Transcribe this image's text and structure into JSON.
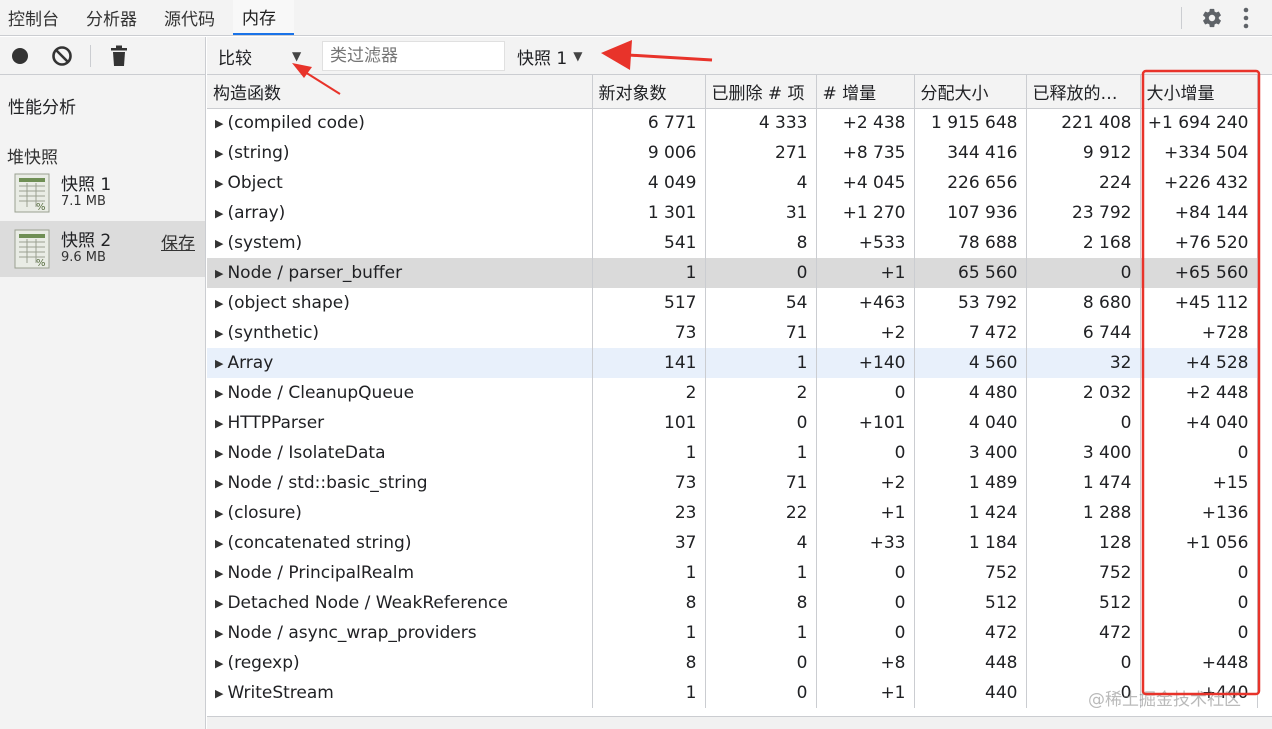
{
  "tabs": [
    {
      "label": "控制台"
    },
    {
      "label": "分析器"
    },
    {
      "label": "源代码"
    },
    {
      "label": "内存"
    }
  ],
  "sidebar": {
    "profiles_title": "性能分析",
    "heap_title": "堆快照",
    "snapshots": [
      {
        "name": "快照 1",
        "size": "7.1 MB"
      },
      {
        "name": "快照 2",
        "size": "9.6 MB",
        "action": "保存"
      }
    ]
  },
  "toolbar": {
    "view_label": "比较",
    "filter_placeholder": "类过滤器",
    "baseline_label": "快照 1"
  },
  "table": {
    "columns": [
      "构造函数",
      "新对象数",
      "已删除 # 项",
      "# 增量",
      "分配大小",
      "已释放的…",
      "大小增量"
    ],
    "rows": [
      {
        "name": "(compiled code)",
        "new": "6 771",
        "deleted": "4 333",
        "delta": "+2 438",
        "alloc": "1 915 648",
        "freed": "221 408",
        "size_delta": "+1 694 240"
      },
      {
        "name": "(string)",
        "new": "9 006",
        "deleted": "271",
        "delta": "+8 735",
        "alloc": "344 416",
        "freed": "9 912",
        "size_delta": "+334 504"
      },
      {
        "name": "Object",
        "new": "4 049",
        "deleted": "4",
        "delta": "+4 045",
        "alloc": "226 656",
        "freed": "224",
        "size_delta": "+226 432"
      },
      {
        "name": "(array)",
        "new": "1 301",
        "deleted": "31",
        "delta": "+1 270",
        "alloc": "107 936",
        "freed": "23 792",
        "size_delta": "+84 144"
      },
      {
        "name": "(system)",
        "new": "541",
        "deleted": "8",
        "delta": "+533",
        "alloc": "78 688",
        "freed": "2 168",
        "size_delta": "+76 520"
      },
      {
        "name": "Node / parser_buffer",
        "new": "1",
        "deleted": "0",
        "delta": "+1",
        "alloc": "65 560",
        "freed": "0",
        "size_delta": "+65 560"
      },
      {
        "name": "(object shape)",
        "new": "517",
        "deleted": "54",
        "delta": "+463",
        "alloc": "53 792",
        "freed": "8 680",
        "size_delta": "+45 112"
      },
      {
        "name": "(synthetic)",
        "new": "73",
        "deleted": "71",
        "delta": "+2",
        "alloc": "7 472",
        "freed": "6 744",
        "size_delta": "+728"
      },
      {
        "name": "Array",
        "new": "141",
        "deleted": "1",
        "delta": "+140",
        "alloc": "4 560",
        "freed": "32",
        "size_delta": "+4 528"
      },
      {
        "name": "Node / CleanupQueue",
        "new": "2",
        "deleted": "2",
        "delta": "0",
        "alloc": "4 480",
        "freed": "2 032",
        "size_delta": "+2 448"
      },
      {
        "name": "HTTPParser",
        "new": "101",
        "deleted": "0",
        "delta": "+101",
        "alloc": "4 040",
        "freed": "0",
        "size_delta": "+4 040"
      },
      {
        "name": "Node / IsolateData",
        "new": "1",
        "deleted": "1",
        "delta": "0",
        "alloc": "3 400",
        "freed": "3 400",
        "size_delta": "0"
      },
      {
        "name": "Node / std::basic_string",
        "new": "73",
        "deleted": "71",
        "delta": "+2",
        "alloc": "1 489",
        "freed": "1 474",
        "size_delta": "+15"
      },
      {
        "name": "(closure)",
        "new": "23",
        "deleted": "22",
        "delta": "+1",
        "alloc": "1 424",
        "freed": "1 288",
        "size_delta": "+136"
      },
      {
        "name": "(concatenated string)",
        "new": "37",
        "deleted": "4",
        "delta": "+33",
        "alloc": "1 184",
        "freed": "128",
        "size_delta": "+1 056"
      },
      {
        "name": "Node / PrincipalRealm",
        "new": "1",
        "deleted": "1",
        "delta": "0",
        "alloc": "752",
        "freed": "752",
        "size_delta": "0"
      },
      {
        "name": "Detached Node / WeakReference",
        "new": "8",
        "deleted": "8",
        "delta": "0",
        "alloc": "512",
        "freed": "512",
        "size_delta": "0"
      },
      {
        "name": "Node / async_wrap_providers",
        "new": "1",
        "deleted": "1",
        "delta": "0",
        "alloc": "472",
        "freed": "472",
        "size_delta": "0"
      },
      {
        "name": "(regexp)",
        "new": "8",
        "deleted": "0",
        "delta": "+8",
        "alloc": "448",
        "freed": "0",
        "size_delta": "+448"
      },
      {
        "name": "WriteStream",
        "new": "1",
        "deleted": "0",
        "delta": "+1",
        "alloc": "440",
        "freed": "0",
        "size_delta": "+440"
      }
    ]
  },
  "watermark": "@稀土掘金技术社区",
  "colors": {
    "annotation": "#e8332a",
    "selected_row": "#dadada",
    "hover_row": "#e8f0fb",
    "accent": "#1a73e8"
  }
}
